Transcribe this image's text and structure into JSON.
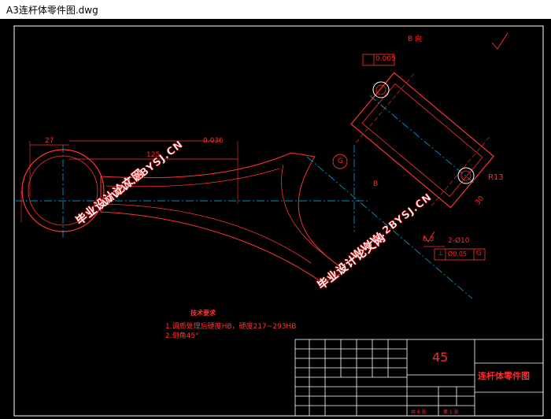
{
  "window": {
    "title": "A3连杆体零件图.dwg"
  },
  "drawing": {
    "dimensions": {
      "d27": "27",
      "d125": "125",
      "d036": "0.036",
      "view_b": "B 向",
      "flatness": "0.005",
      "d63": "6.3",
      "hole": "2-Ø10",
      "perp": "⊥",
      "perp_tol": "Ø0.05",
      "datum_g": "G",
      "r13": "R13",
      "d30": "30",
      "b_label": "B",
      "datum_g_circle": "G"
    },
    "tech_req": {
      "title": "技术要求",
      "line1": "1.调质处理后硬度HB，硬度217~293HB",
      "line2": "2.倒角45°"
    },
    "watermark": {
      "cn": "毕业设计论文网",
      "url": "WWW.2BYSJ.CN"
    },
    "title_block": {
      "material": "45",
      "part_name": "连杆体零件图",
      "sheets_total": "共 6 张",
      "sheet_no": "第 1 张"
    }
  }
}
